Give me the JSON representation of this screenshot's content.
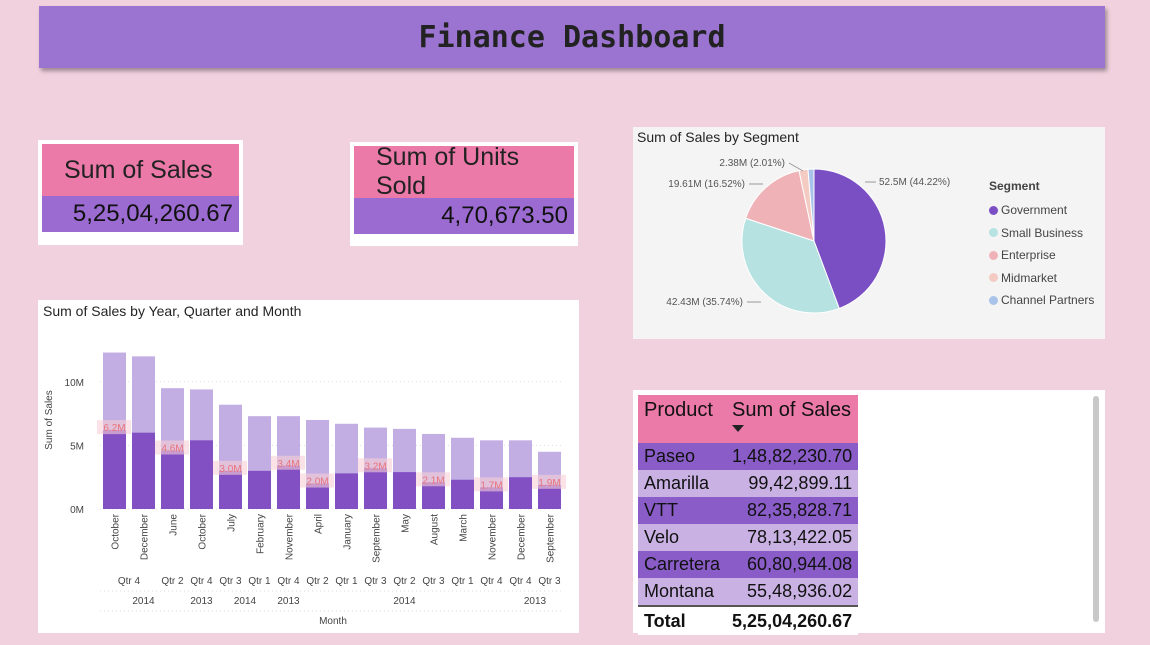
{
  "header": {
    "title": "Finance Dashboard"
  },
  "kpis": {
    "sales": {
      "label": "Sum of Sales",
      "value": "5,25,04,260.67"
    },
    "units": {
      "label": "Sum of Units Sold",
      "value": "4,70,673.50"
    }
  },
  "segment_chart": {
    "title": "Sum of Sales by Segment",
    "legend_title": "Segment",
    "colors": {
      "Government": "#7b4fc4",
      "Small Business": "#b6e2e2",
      "Enterprise": "#efb3b7",
      "Midmarket": "#f4cbc2",
      "Channel Partners": "#a9c3ea"
    }
  },
  "product_table": {
    "headers": [
      "Product",
      "Sum of Sales"
    ],
    "rows": [
      {
        "product": "Paseo",
        "sales": "1,48,82,230.70"
      },
      {
        "product": "Amarilla",
        "sales": "99,42,899.11"
      },
      {
        "product": "VTT",
        "sales": "82,35,828.71"
      },
      {
        "product": "Velo",
        "sales": "78,13,422.05"
      },
      {
        "product": "Carretera",
        "sales": "60,80,944.08"
      },
      {
        "product": "Montana",
        "sales": "55,48,936.02"
      }
    ],
    "total_label": "Total",
    "total_value": "5,25,04,260.67"
  },
  "chart_data": [
    {
      "type": "pie",
      "title": "Sum of Sales by Segment",
      "legend_title": "Segment",
      "legend_position": "right",
      "slices": [
        {
          "name": "Government",
          "value": 52.5,
          "label": "52.5M (44.22%)"
        },
        {
          "name": "Small Business",
          "value": 42.43,
          "label": "42.43M (35.74%)"
        },
        {
          "name": "Enterprise",
          "value": 19.61,
          "label": "19.61M (16.52%)"
        },
        {
          "name": "Midmarket",
          "value": 2.38,
          "label": "2.38M (2.01%)"
        },
        {
          "name": "Channel Partners",
          "value": 1.58,
          "label": ""
        }
      ]
    },
    {
      "type": "bar",
      "title": "Sum of Sales by Year, Quarter and Month",
      "xlabel": "Month",
      "ylabel": "Sum of Sales",
      "ylim": [
        0,
        12500000
      ],
      "y_ticks": [
        {
          "v": 0,
          "t": "0M"
        },
        {
          "v": 5000000,
          "t": "5M"
        },
        {
          "v": 10000000,
          "t": "10M"
        }
      ],
      "grid": true,
      "categories": [
        "October",
        "December",
        "June",
        "October",
        "July",
        "February",
        "November",
        "April",
        "January",
        "September",
        "May",
        "August",
        "March",
        "November",
        "December",
        "September"
      ],
      "quarters": [
        {
          "label": "Qtr 4",
          "span": 2
        },
        {
          "label": "Qtr 2",
          "span": 1
        },
        {
          "label": "Qtr 4",
          "span": 1
        },
        {
          "label": "Qtr 3",
          "span": 1
        },
        {
          "label": "Qtr 1",
          "span": 1
        },
        {
          "label": "Qtr 4",
          "span": 1
        },
        {
          "label": "Qtr 2",
          "span": 1
        },
        {
          "label": "Qtr 1",
          "span": 1
        },
        {
          "label": "Qtr 3",
          "span": 1
        },
        {
          "label": "Qtr 2",
          "span": 1
        },
        {
          "label": "Qtr 3",
          "span": 1
        },
        {
          "label": "Qtr 1",
          "span": 1
        },
        {
          "label": "Qtr 4",
          "span": 1
        },
        {
          "label": "Qtr 4",
          "span": 1
        },
        {
          "label": "Qtr 3",
          "span": 1
        }
      ],
      "years": [
        {
          "label": "2014",
          "span": 3
        },
        {
          "label": "2013",
          "span": 1
        },
        {
          "label": "2014",
          "span": 2
        },
        {
          "label": "2013",
          "span": 1
        },
        {
          "label": "2014",
          "span": 7
        },
        {
          "label": "2013",
          "span": 2
        }
      ],
      "series": [
        {
          "values": [
            12300000,
            12000000,
            9500000,
            9400000,
            8200000,
            7300000,
            7300000,
            7000000,
            6700000,
            6400000,
            6300000,
            5900000,
            5600000,
            5400000,
            5400000,
            4500000
          ],
          "color": "#c3aee3"
        },
        {
          "values": [
            6200000,
            6000000,
            4600000,
            5400000,
            3000000,
            3000000,
            3400000,
            2000000,
            2800000,
            3200000,
            2900000,
            2100000,
            2300000,
            1700000,
            2500000,
            1900000
          ],
          "color": "#8350c4"
        }
      ],
      "data_labels": [
        "6.2M",
        "",
        "4.6M",
        "",
        "3.0M",
        "",
        "3.4M",
        "2.0M",
        "",
        "3.2M",
        "",
        "2.1M",
        "",
        "1.7M",
        "",
        "1.9M"
      ]
    }
  ]
}
